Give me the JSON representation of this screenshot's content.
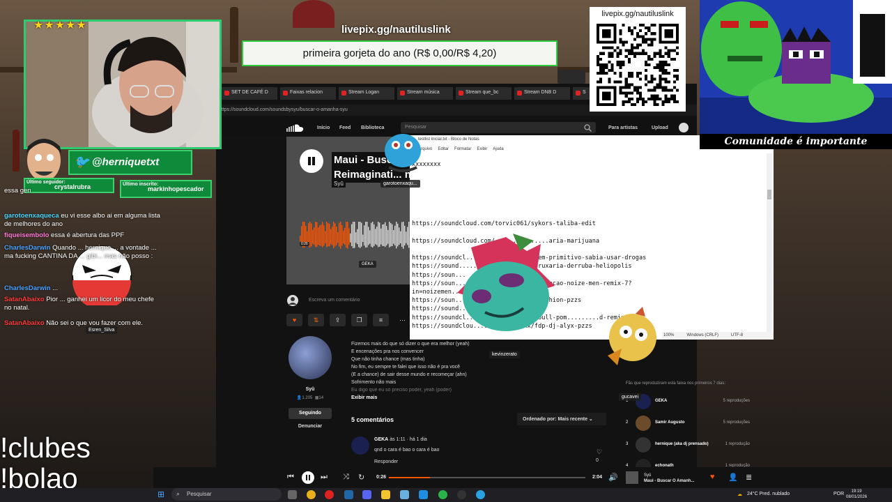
{
  "donation": {
    "url": "livepix.gg/nautiluslink",
    "goal_text": "primeira gorjeta do ano (R$ 0,00/R$ 4,20)"
  },
  "qr": {
    "label": "livepix.gg/nautiluslink"
  },
  "pixel_art": {
    "caption": "Comunidade é importante"
  },
  "webcam": {
    "rating_stars": "★★★★★"
  },
  "social": {
    "twitter": "@herniquetxt",
    "last_follower_label": "Último seguidor:",
    "last_follower": "crystalrubra",
    "last_sub_label": "Último inscrito:",
    "last_sub": "markinhopescador"
  },
  "chat": [
    {
      "user": "",
      "text": "essa gen"
    },
    {
      "user": "garotoenxaqueca",
      "text": "eu vi esse albo ai em alguma lista de melhores do ano"
    },
    {
      "user": "fiqueisembolo",
      "text": "essa é abertura das PPF"
    },
    {
      "user": "CharlesDarwin",
      "text": "Quando ... hernique.... a vontade ... ma fucking CANTINA DA ... gibi... mas não posso :"
    },
    {
      "user": "CharlesDarwin",
      "text": "..."
    },
    {
      "user": "SatanAbaixo",
      "text": "Pior ... ganhei um licor do meu chefe no natal."
    },
    {
      "user": "SatanAbaixo",
      "text": "Não sei o que vou fazer com ele."
    }
  ],
  "chat_tags": {
    "esren": "Esren_Silva",
    "garoto": "garotoenxaqu...",
    "kevin": "kevinzerato",
    "gucavei": "gucavei"
  },
  "commands": [
    "!clubes",
    "!bolao"
  ],
  "browser": {
    "tabs": [
      "SET DE CAFÉ D",
      "Faixas relacion",
      "Stream Logan",
      "Stream música",
      "Stream que_bc",
      "Stream DNB D",
      "S"
    ],
    "url": "https://soundcloud.com/soundsbysyu/buscar-o-amanha-syu"
  },
  "soundcloud": {
    "nav": {
      "home": "Início",
      "feed": "Feed",
      "library": "Biblioteca",
      "search_placeholder": "Pesquisar",
      "artists": "Para artistas",
      "upload": "Upload"
    },
    "track": {
      "title_line1": "Maui - Busca",
      "title_line2": "Reimaginati... n)",
      "artist": "Syû",
      "elapsed_small": "0:26",
      "commenter_tag": "GEKA"
    },
    "comment_placeholder": "Escreva um comentário",
    "artist_card": {
      "name": "Syû",
      "followers": "1.205",
      "tracks": "14",
      "following_label": "Seguindo",
      "report_label": "Denunciar"
    },
    "lyrics": [
      "Fizemos mais do que só dizer o que era melhor (yeah)",
      "E encenações pra nos convencer",
      "Que não tinha chance (mas tinha)",
      "No fim, eu sempre te falei que isso não é pra você",
      "(E a chance) de sair desse mundo e recomeçar (ahn)",
      "Sofrimento não mais",
      "Eu digo que eu só preciso poder, yeah (poder)"
    ],
    "show_more": "Exibir mais",
    "comments_title": "5 comentários",
    "sort_label": "Ordenado por: Mais recente",
    "comment": {
      "user": "GEKA",
      "when": "às 1:11 · há 1 dia",
      "text": "qnd o cara é bao o cara é bao",
      "reply": "Responder",
      "likes": "0"
    },
    "listeners_title": "Fãs que reproduziram esta faixa nos primeiros 7 dias:",
    "listeners": [
      {
        "rank": "1",
        "name": "GEKA",
        "count": "5 reproduções"
      },
      {
        "rank": "2",
        "name": "Samir Augusto",
        "count": "5 reproduções"
      },
      {
        "rank": "3",
        "name": "hernique (aka dj prensado)",
        "count": "1 reprodução"
      },
      {
        "rank": "4",
        "name": "echonath",
        "count": "1 reprodução"
      }
    ],
    "player": {
      "elapsed": "0:26",
      "duration": "2:04",
      "progress": 0.21,
      "track_artist": "Syû",
      "track_title": "Maui - Buscar O Amanh..."
    }
  },
  "notepad": {
    "title": "testlist inicial.txt - Bloco de Notas",
    "menu": [
      "Arquivo",
      "Editar",
      "Formatar",
      "Exibir",
      "Ajuda"
    ],
    "lines": [
      "xxxxxxxx",
      "",
      "",
      "",
      "",
      "",
      "",
      "https://soundcloud.com/torvic061/sykors-taliba-edit",
      "",
      "https://soundcloud.com/...............aria-marijuana",
      "",
      "https://soundcl.............g-o-homem-primitivo-sabia-usar-drogas",
      "https://sound.................ais/bruxaria-derruba-heliopolis",
      "https://soun...",
      "https://soun...............-em-mim-xerecao-noize-men-remix-7?",
      "in=noizemen...",
      "https://soun............outh-icone-fashion-pzzs",
      "https://sound.............ctoria",
      "https://soundcl...........540-bia-soull-pom.........d-remix",
      "https://soundclou.........alyx xx/fdp-dj-alyx-pzzs"
    ],
    "status": {
      "zoom": "100%",
      "line_ending": "Windows (CRLF)",
      "encoding": "UTF-8"
    }
  },
  "taskbar": {
    "search_placeholder": "Pesquisar",
    "weather": "24°C Pred. nublado",
    "lang": "POR",
    "time": "19:19",
    "date": "08/01/2026"
  }
}
